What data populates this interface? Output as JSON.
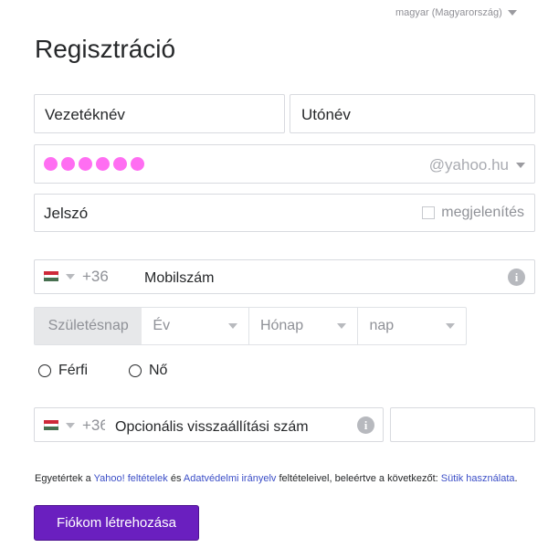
{
  "language": {
    "label": "magyar (Magyarország)"
  },
  "page_title": "Regisztráció",
  "form": {
    "last_name_placeholder": "Vezetéknév",
    "first_name_placeholder": "Utónév",
    "email_domain": "@yahoo.hu",
    "password_placeholder": "Jelszó",
    "show_password_label": "megjelenítés",
    "phone_country_code": "+36",
    "phone_placeholder": "Mobilszám",
    "birthday_label": "Születésnap",
    "year_placeholder": "Év",
    "month_placeholder": "Hónap",
    "day_placeholder": "nap",
    "gender_male": "Férfi",
    "gender_female": "Nő",
    "recovery_country_code": "+36",
    "recovery_placeholder": "Opcionális visszaállítási szám"
  },
  "legal": {
    "prefix": "Egyetértek a ",
    "terms_link": "Yahoo! feltételek",
    "and": " és ",
    "privacy_link": "Adatvédelmi irányelv",
    "middle": " feltételeivel, beleértve a következőt: ",
    "cookies_link": "Sütik használata",
    "suffix": "."
  },
  "submit_label": "Fiókom létrehozása",
  "colors": {
    "accent": "#6a1fbf",
    "link": "#3b4ec7",
    "masked_email": "#ff6ef2"
  },
  "icons": [
    "chevron-down-icon",
    "hungary-flag-icon",
    "info-icon",
    "checkbox-icon",
    "radio-icon"
  ]
}
